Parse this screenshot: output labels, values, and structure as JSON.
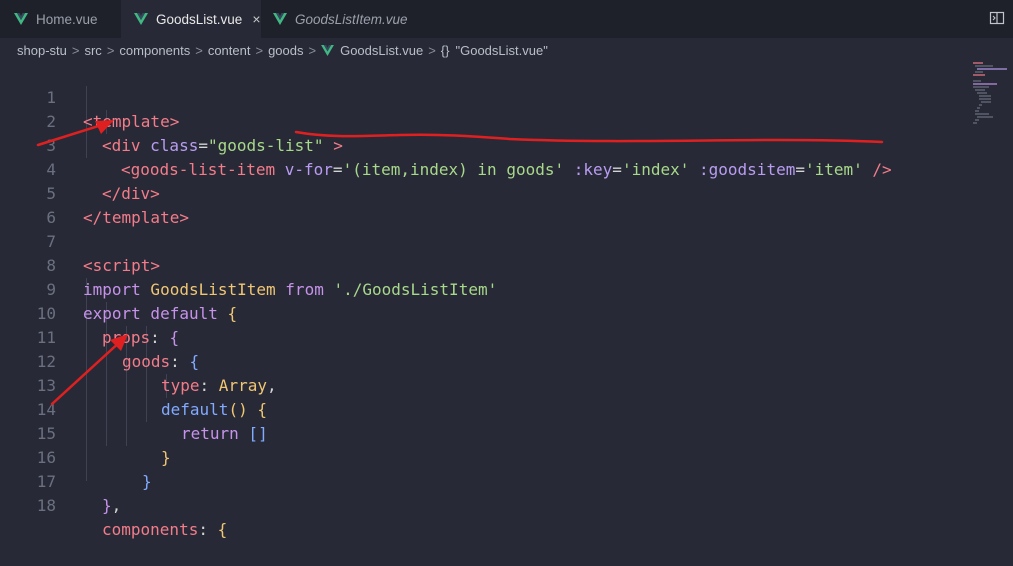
{
  "tabs": [
    {
      "label": "Home.vue",
      "active": false
    },
    {
      "label": "GoodsList.vue",
      "active": true,
      "close": "×"
    },
    {
      "label": "GoodsListItem.vue",
      "active": false
    }
  ],
  "breadcrumb": {
    "parts": [
      "shop-stu",
      "src",
      "components",
      "content",
      "goods",
      "GoodsList.vue",
      "\"GoodsList.vue\""
    ],
    "separator": ">",
    "braces": "{}"
  },
  "lines": [
    {
      "n": "1"
    },
    {
      "n": "2"
    },
    {
      "n": "3"
    },
    {
      "n": "4"
    },
    {
      "n": "5"
    },
    {
      "n": "6"
    },
    {
      "n": "7"
    },
    {
      "n": "8"
    },
    {
      "n": "9"
    },
    {
      "n": "10"
    },
    {
      "n": "11"
    },
    {
      "n": "12"
    },
    {
      "n": "13"
    },
    {
      "n": "14"
    },
    {
      "n": "15"
    },
    {
      "n": "16"
    },
    {
      "n": "17"
    },
    {
      "n": "18"
    }
  ],
  "code": {
    "l1": [
      "<template>"
    ],
    "l2": [
      "<div",
      " class",
      "=",
      "\"goods-list\"",
      " >"
    ],
    "l3": [
      "<goods-list-item",
      " v-for",
      "=",
      "'(item,index) in goods'",
      " :key",
      "=",
      "'index'",
      " :goodsitem",
      "=",
      "'item'",
      " />"
    ],
    "l4": [
      "</div>"
    ],
    "l5": [
      "</template>"
    ],
    "l7": [
      "<script>"
    ],
    "l8": [
      "import",
      " GoodsListItem ",
      "from",
      " './GoodsListItem'"
    ],
    "l9": [
      "export",
      " default",
      " {"
    ],
    "l10": [
      "props",
      ":",
      " {"
    ],
    "l11": [
      "goods",
      ":",
      " {"
    ],
    "l12": [
      "type",
      ":",
      " Array",
      ","
    ],
    "l13": [
      "default",
      "()",
      " {"
    ],
    "l14": [
      "return",
      " []"
    ],
    "l15": [
      "}"
    ],
    "l16": [
      "}"
    ],
    "l17": [
      "}",
      ","
    ],
    "l18": [
      "components",
      ":",
      " {"
    ]
  },
  "colors": {
    "annotation": "#e02020",
    "vue_logo": "#41b883"
  }
}
